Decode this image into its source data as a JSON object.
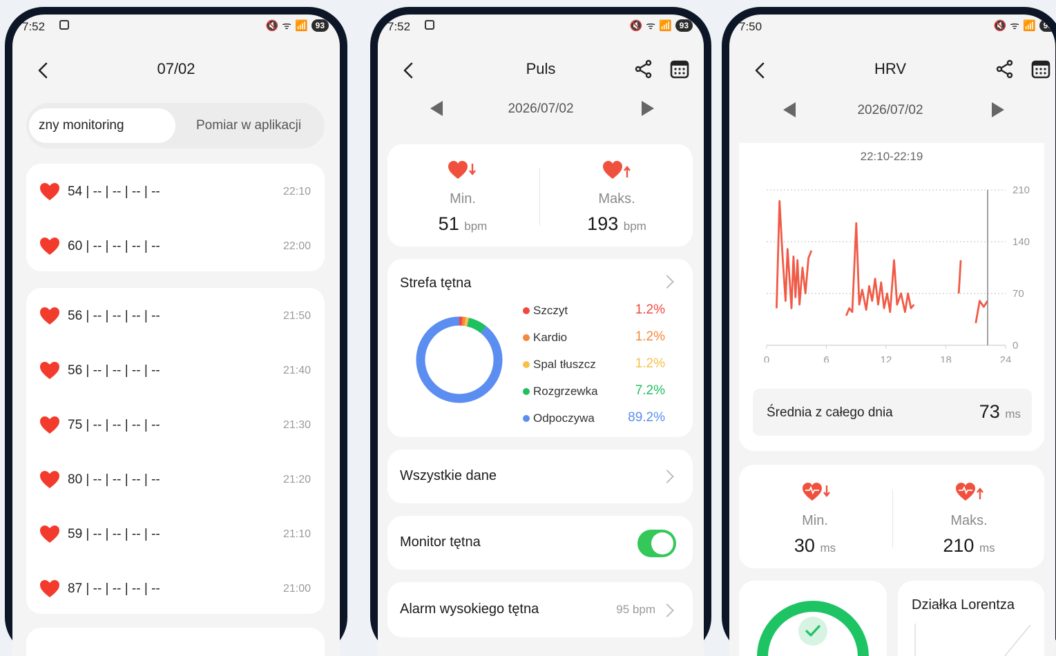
{
  "status": {
    "battery": "93"
  },
  "phone1": {
    "time": "7:52",
    "title": "07/02",
    "tabs": {
      "active": "zny monitoring",
      "inactive": "Pomiar w aplikacji"
    },
    "group1": [
      {
        "value": "54 | -- | -- | -- | --",
        "time": "22:10"
      },
      {
        "value": "60 | -- | -- | -- | --",
        "time": "22:00"
      }
    ],
    "group2": [
      {
        "value": "56 | -- | -- | -- | --",
        "time": "21:50"
      },
      {
        "value": "56 | -- | -- | -- | --",
        "time": "21:40"
      },
      {
        "value": "75 | -- | -- | -- | --",
        "time": "21:30"
      },
      {
        "value": "80 | -- | -- | -- | --",
        "time": "21:20"
      },
      {
        "value": "59 | -- | -- | -- | --",
        "time": "21:10"
      },
      {
        "value": "87 | -- | -- | -- | --",
        "time": "21:00"
      }
    ]
  },
  "phone2": {
    "time": "7:52",
    "title": "Puls",
    "date": "2026/07/02",
    "min": {
      "label": "Min.",
      "value": "51",
      "unit": "bpm"
    },
    "max": {
      "label": "Maks.",
      "value": "193",
      "unit": "bpm"
    },
    "zone_title": "Strefa tętna",
    "zones": [
      {
        "name": "Szczyt",
        "pct": "1.2%",
        "color": "#f0483e",
        "value": 1.2
      },
      {
        "name": "Kardio",
        "pct": "1.2%",
        "color": "#f5883a",
        "value": 1.2
      },
      {
        "name": "Spal tłuszcz",
        "pct": "1.2%",
        "color": "#f7c04a",
        "value": 1.2
      },
      {
        "name": "Rozgrzewka",
        "pct": "7.2%",
        "color": "#20c060",
        "value": 7.2
      },
      {
        "name": "Odpoczywa",
        "pct": "89.2%",
        "color": "#5b8ef0",
        "value": 89.2
      }
    ],
    "all_data": "Wszystkie dane",
    "monitor": "Monitor tętna",
    "alarm": "Alarm wysokiego tętna",
    "alarm_value": "95 bpm"
  },
  "phone3": {
    "time": "7:50",
    "title": "HRV",
    "date": "2026/07/02",
    "range": "22:10-22:19",
    "avg_label": "Średnia z całego dnia",
    "avg_value": "73",
    "avg_unit": "ms",
    "min": {
      "label": "Min.",
      "value": "30",
      "unit": "ms"
    },
    "max": {
      "label": "Maks.",
      "value": "210",
      "unit": "ms"
    },
    "lorentz": "Działka Lorentza"
  },
  "chart_data": {
    "type": "line",
    "x_ticks": [
      "0",
      "6",
      "12",
      "18",
      "24"
    ],
    "y_ticks": [
      "210",
      "140",
      "70",
      "0"
    ],
    "xlim": [
      0,
      24
    ],
    "ylim": [
      0,
      210
    ],
    "series": [
      {
        "segments": [
          [
            [
              1.0,
              50
            ],
            [
              1.3,
              195
            ],
            [
              1.6,
              120
            ],
            [
              1.9,
              60
            ],
            [
              2.1,
              130
            ],
            [
              2.3,
              90
            ],
            [
              2.5,
              50
            ],
            [
              2.7,
              120
            ],
            [
              2.9,
              65
            ],
            [
              3.1,
              115
            ],
            [
              3.3,
              55
            ],
            [
              3.6,
              105
            ],
            [
              3.9,
              70
            ],
            [
              4.2,
              118
            ],
            [
              4.5,
              128
            ]
          ],
          [
            [
              8.0,
              40
            ],
            [
              8.3,
              50
            ],
            [
              8.6,
              45
            ],
            [
              9.0,
              165
            ],
            [
              9.3,
              55
            ],
            [
              9.6,
              75
            ],
            [
              10.0,
              48
            ],
            [
              10.3,
              80
            ],
            [
              10.6,
              60
            ],
            [
              10.9,
              90
            ],
            [
              11.2,
              55
            ],
            [
              11.5,
              85
            ],
            [
              11.8,
              50
            ],
            [
              12.1,
              70
            ],
            [
              12.4,
              45
            ],
            [
              12.8,
              115
            ],
            [
              13.1,
              55
            ],
            [
              13.5,
              70
            ],
            [
              13.9,
              45
            ],
            [
              14.2,
              70
            ],
            [
              14.5,
              50
            ],
            [
              14.8,
              55
            ]
          ],
          [
            [
              19.3,
              70
            ],
            [
              19.5,
              115
            ]
          ],
          [
            [
              21.0,
              30
            ],
            [
              21.4,
              60
            ],
            [
              21.8,
              52
            ],
            [
              22.2,
              60
            ]
          ]
        ]
      }
    ],
    "cursor_x": 22.2,
    "color": "#f05a46"
  }
}
